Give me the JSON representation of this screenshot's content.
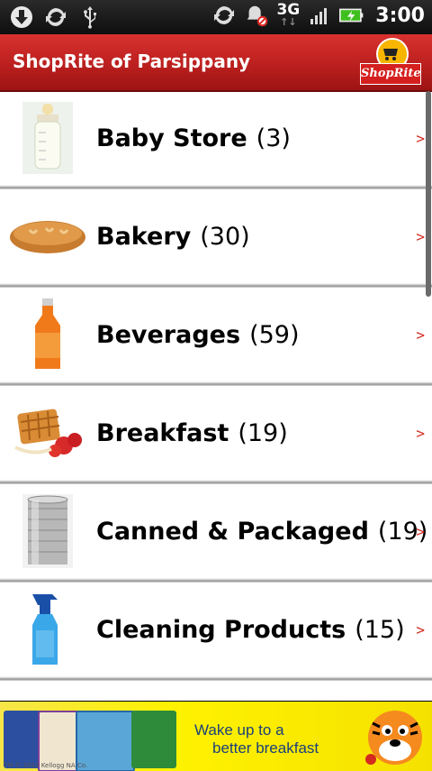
{
  "status_bar": {
    "network": "3G",
    "time": "3:00",
    "icons": [
      "download-icon",
      "sync-icon",
      "usb-icon",
      "sync-icon",
      "notification-muted-icon",
      "signal-icon",
      "battery-charging-icon"
    ]
  },
  "header": {
    "title": "ShopRite of Parsippany",
    "logo_text": "ShopRite"
  },
  "categories": [
    {
      "name": "Baby Store",
      "count": "(3)",
      "icon": "baby-bottle-icon"
    },
    {
      "name": "Bakery",
      "count": "(30)",
      "icon": "bread-icon"
    },
    {
      "name": "Beverages",
      "count": "(59)",
      "icon": "juice-bottle-icon"
    },
    {
      "name": "Breakfast",
      "count": "(19)",
      "icon": "waffle-icon"
    },
    {
      "name": "Canned & Packaged",
      "count": "(19)",
      "icon": "tin-can-icon"
    },
    {
      "name": "Cleaning Products",
      "count": "(15)",
      "icon": "spray-bottle-icon"
    }
  ],
  "chevron": ">",
  "ad": {
    "line1": "Wake up to a",
    "line2": "better breakfast",
    "fine_print": "TM © 2010 Kellogg NA Co."
  },
  "colors": {
    "header_red": "#c5221f",
    "chevron_red": "#d42a20",
    "ad_yellow": "#fff200"
  }
}
